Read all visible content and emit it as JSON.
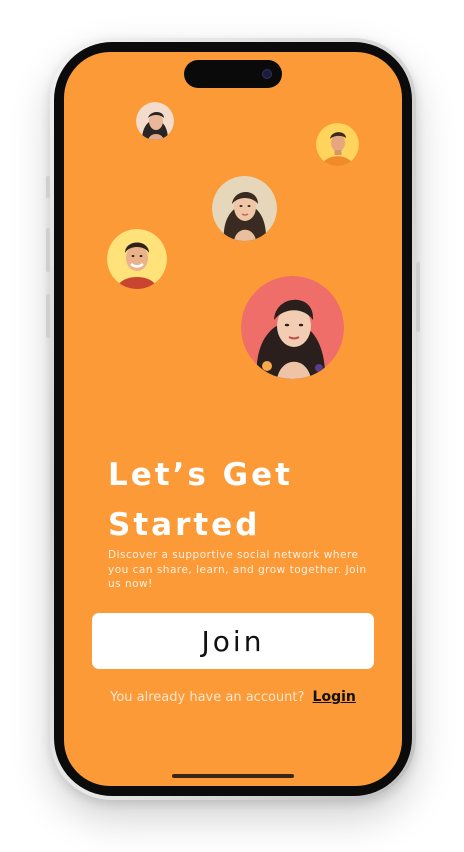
{
  "onboarding": {
    "title_line1": "Let’s Get",
    "title_line2": "Started",
    "subtitle": "Discover a supportive social network where you can share, learn, and grow together. Join us now!",
    "join_label": "Join",
    "login_prompt": "You already have an account?",
    "login_label": "Login"
  },
  "colors": {
    "background": "#fb9a37",
    "button_bg": "#ffffff",
    "text_light": "#ffffff",
    "text_dark": "#111111"
  },
  "avatars": [
    {
      "name": "avatar-woman-dark-hair",
      "bg": "#f2d9c9"
    },
    {
      "name": "avatar-man-orange-shirt",
      "bg": "#ffd45c"
    },
    {
      "name": "avatar-woman-long-hair",
      "bg": "#e8d8b8"
    },
    {
      "name": "avatar-man-smiling",
      "bg": "#ffe27a"
    },
    {
      "name": "avatar-woman-red-bg",
      "bg": "#ef6e6a"
    }
  ]
}
